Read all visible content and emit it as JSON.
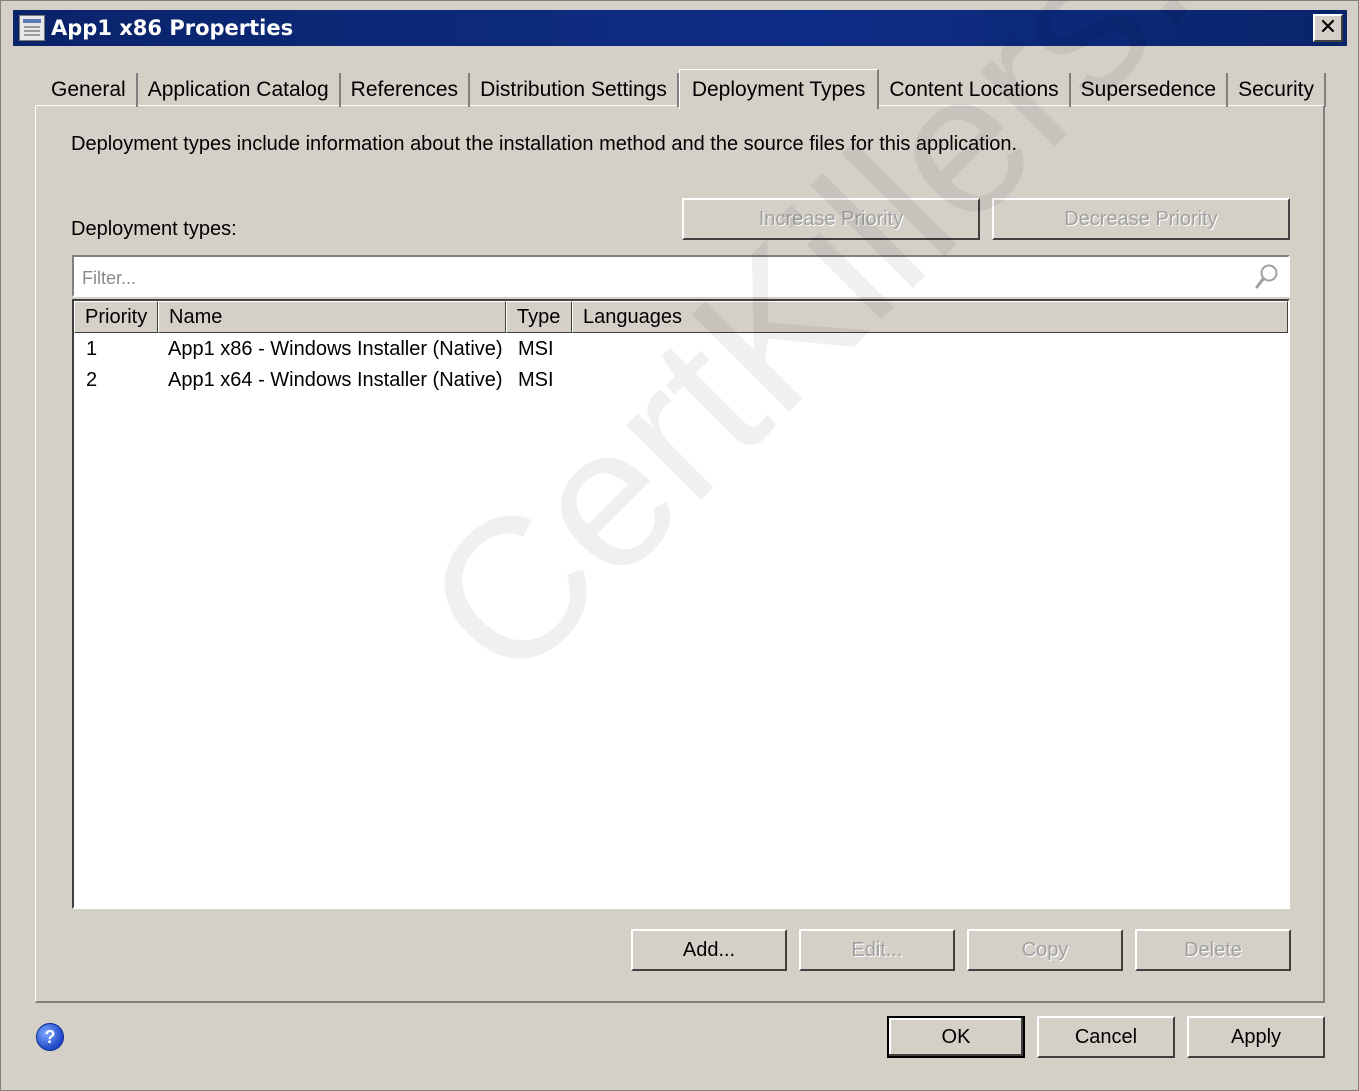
{
  "window": {
    "title": "App1 x86 Properties",
    "close_label": "✕"
  },
  "tabs": [
    {
      "label": "General"
    },
    {
      "label": "Application Catalog"
    },
    {
      "label": "References"
    },
    {
      "label": "Distribution Settings"
    },
    {
      "label": "Deployment Types",
      "active": true
    },
    {
      "label": "Content Locations"
    },
    {
      "label": "Supersedence"
    },
    {
      "label": "Security"
    }
  ],
  "panel": {
    "description": "Deployment types include information about the installation method and the source files for this application.",
    "list_label": "Deployment types:",
    "increase_priority": "Increase Priority",
    "decrease_priority": "Decrease Priority",
    "filter_placeholder": "Filter..."
  },
  "list": {
    "columns": [
      "Priority",
      "Name",
      "Type",
      "Languages"
    ],
    "rows": [
      {
        "priority": "1",
        "name": "App1 x86 - Windows Installer (Native)",
        "type": "MSI",
        "languages": ""
      },
      {
        "priority": "2",
        "name": "App1 x64 - Windows Installer (Native)",
        "type": "MSI",
        "languages": ""
      }
    ]
  },
  "actions": {
    "add": "Add...",
    "edit": "Edit...",
    "copy": "Copy",
    "delete": "Delete"
  },
  "footer": {
    "help": "?",
    "ok": "OK",
    "cancel": "Cancel",
    "apply": "Apply"
  },
  "watermark": "CertKillers.net"
}
